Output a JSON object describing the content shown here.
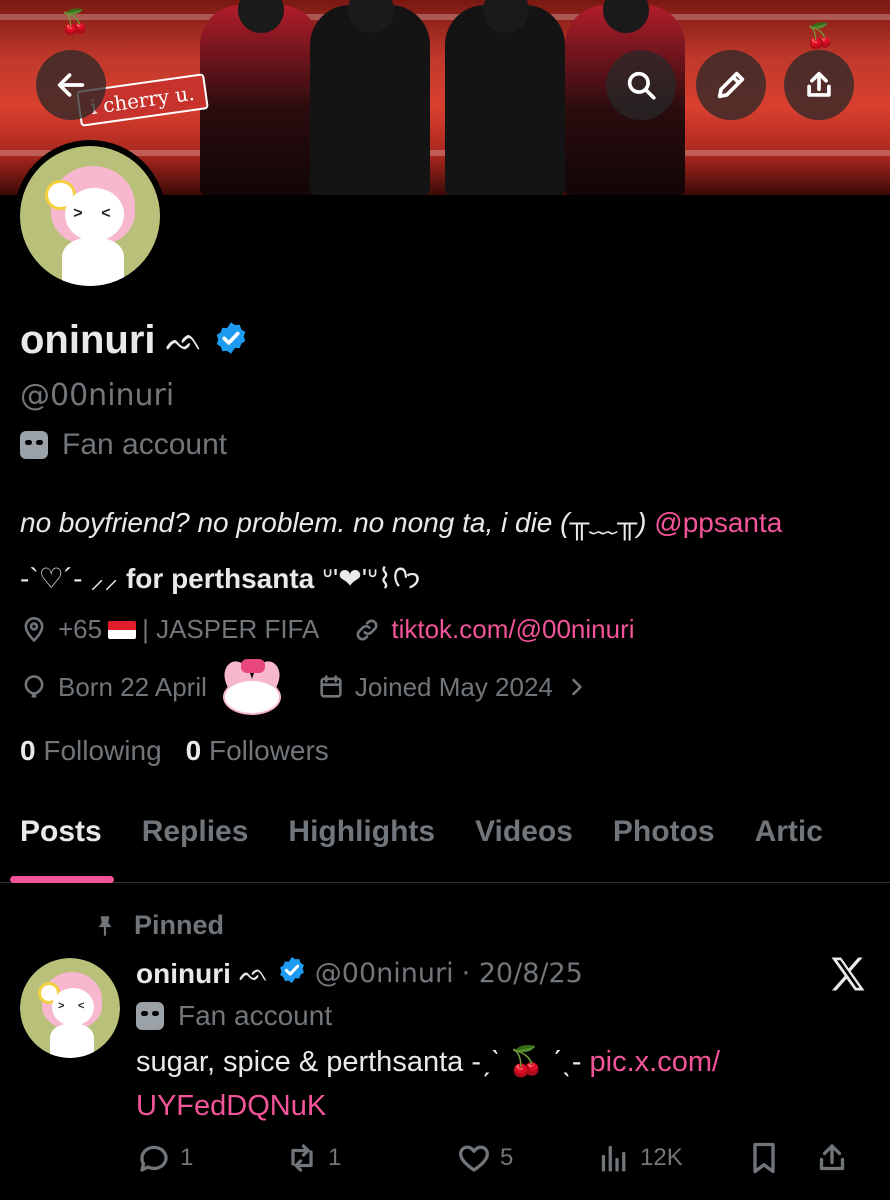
{
  "banner": {
    "sticker_text": "i cherry u."
  },
  "profile": {
    "display_name": "oninuri",
    "name_decoration": "ᨒ",
    "handle": "@00ninuri",
    "label": "Fan account",
    "bio_line1_text": "no boyfriend? no problem. no nong ta, i die (╥﹏╥)",
    "bio_line1_mention": "@ppsanta",
    "bio_line2_prefix": "-`♡´- ⸝⸝",
    "bio_line2_bold": "for perthsanta",
    "bio_line2_suffix": "ᐡ'❤'ᐡ⌇ᢉ𐭩",
    "location": "+65",
    "location_suffix": "| JASPER FIFA",
    "website": "tiktok.com/@00ninuri",
    "birthday": "Born 22 April",
    "joined": "Joined May 2024",
    "following_count": "0",
    "following_label": "Following",
    "followers_count": "0",
    "followers_label": "Followers"
  },
  "tabs": [
    "Posts",
    "Replies",
    "Highlights",
    "Videos",
    "Photos",
    "Artic"
  ],
  "pinned_post": {
    "pinned_label": "Pinned",
    "author_name": "oninuri",
    "author_decoration": "ᨒ",
    "author_handle": "@00ninuri",
    "date": "· 20/8/25",
    "author_label": "Fan account",
    "text": "sugar, spice & perthsanta -ˏˋ 🍒 ˊˎ-",
    "link_part1": "pic.x.com/",
    "link_part2": "UYFedDQNuK",
    "replies": "1",
    "reposts": "1",
    "likes": "5",
    "views": "12K"
  },
  "colors": {
    "accent": "#f4549a",
    "verified": "#1d9bf0",
    "muted": "#71767b",
    "text": "#e7e9ea"
  },
  "icons": [
    "back-arrow-icon",
    "search-icon",
    "pencil-icon",
    "share-icon",
    "verified-icon",
    "mask-icon",
    "location-icon",
    "link-icon",
    "balloon-icon",
    "calendar-icon",
    "chevron-right-icon",
    "pin-icon",
    "x-logo-icon",
    "reply-icon",
    "repost-icon",
    "like-icon",
    "views-icon",
    "bookmark-icon"
  ]
}
